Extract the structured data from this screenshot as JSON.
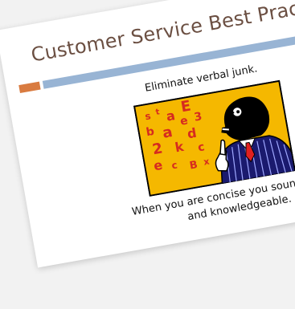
{
  "slide": {
    "title": "Customer Service Best Practices",
    "subtitle": "Eliminate verbal junk.",
    "caption_line1": "When you are concise you sound more p",
    "caption_line2": "and knowledgeable.",
    "clipart": {
      "letters": [
        "s",
        "t",
        "a",
        "E",
        "e",
        "3",
        "b",
        "a",
        "d",
        "2",
        "k",
        "c",
        "e",
        "c",
        "B",
        "x"
      ]
    }
  },
  "colors": {
    "title": "#6b4f42",
    "accent_orange": "#d97b40",
    "accent_blue": "#98b4d4",
    "clipart_background": "#f5b800",
    "clipart_letters": "#d62b1f"
  }
}
